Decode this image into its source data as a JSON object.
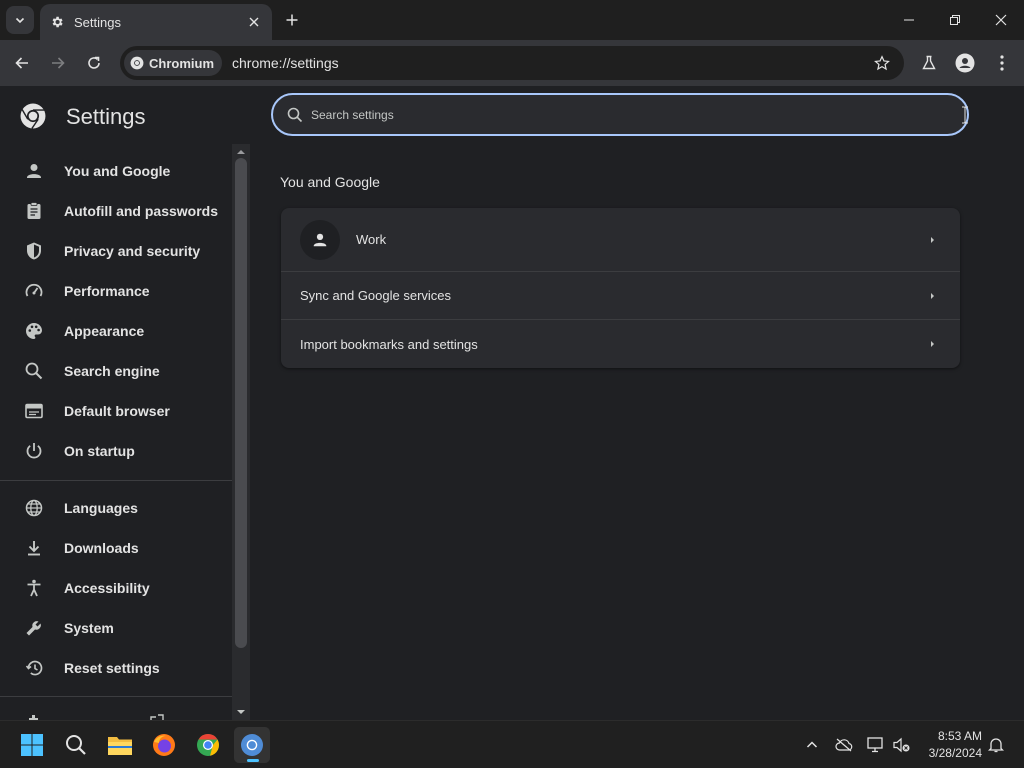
{
  "tab": {
    "title": "Settings"
  },
  "toolbar": {
    "chip_label": "Chromium",
    "url": "chrome://settings"
  },
  "settings": {
    "title": "Settings",
    "search_placeholder": "Search settings",
    "sidebar": {
      "items": [
        {
          "label": "You and Google",
          "icon": "person-icon"
        },
        {
          "label": "Autofill and passwords",
          "icon": "clipboard-icon"
        },
        {
          "label": "Privacy and security",
          "icon": "shield-icon"
        },
        {
          "label": "Performance",
          "icon": "speedometer-icon"
        },
        {
          "label": "Appearance",
          "icon": "palette-icon"
        },
        {
          "label": "Search engine",
          "icon": "search-icon"
        },
        {
          "label": "Default browser",
          "icon": "browser-window-icon"
        },
        {
          "label": "On startup",
          "icon": "power-icon"
        },
        {
          "label": "Languages",
          "icon": "globe-icon"
        },
        {
          "label": "Downloads",
          "icon": "download-icon"
        },
        {
          "label": "Accessibility",
          "icon": "accessibility-icon"
        },
        {
          "label": "System",
          "icon": "wrench-icon"
        },
        {
          "label": "Reset settings",
          "icon": "history-icon"
        }
      ]
    },
    "main": {
      "section_title": "You and Google",
      "rows": [
        {
          "label": "Work"
        },
        {
          "label": "Sync and Google services"
        },
        {
          "label": "Import bookmarks and settings"
        }
      ]
    }
  },
  "taskbar": {
    "time": "8:53 AM",
    "date": "3/28/2024"
  },
  "colors": {
    "accent": "#a8c7fa",
    "background": "#1f2023",
    "card": "#2a2b2f"
  }
}
